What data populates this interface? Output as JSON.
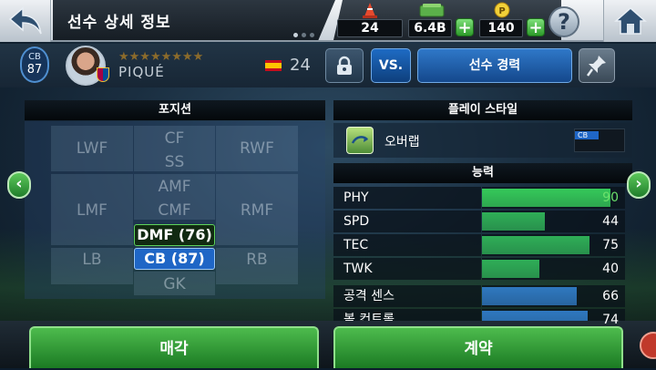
{
  "header": {
    "title": "선수 상세 정보",
    "dots": 3,
    "active_dot": 0
  },
  "resources": {
    "tickets": "24",
    "gp": "6.4B",
    "coins": "140"
  },
  "player": {
    "position": "CB",
    "rating": "87",
    "stars": "★★★★★★★★",
    "name": "PIQUÉ",
    "age": "24",
    "nation": "Spain",
    "club": "FC Barcelona"
  },
  "actions": {
    "vs_label": "VS.",
    "career_label": "선수 경력"
  },
  "positions": {
    "header": "포지션",
    "cells": {
      "lwf": "LWF",
      "cf": "CF",
      "rwf": "RWF",
      "ss": "SS",
      "amf": "AMF",
      "lmf": "LMF",
      "cmf": "CMF",
      "rmf": "RMF",
      "lb": "LB",
      "rb": "RB",
      "gk": "GK"
    },
    "dmf": "DMF (76)",
    "cb": "CB (87)"
  },
  "playstyle": {
    "header": "플레이 스타일",
    "label": "오버랩",
    "tag": "CB"
  },
  "abilities": {
    "header": "능력",
    "stats": [
      {
        "name": "PHY",
        "value": 90,
        "color": "#35c95a",
        "text_color": "#6be06b"
      },
      {
        "name": "SPD",
        "value": 44,
        "color": "#2fae57",
        "text_color": "#ffffff"
      },
      {
        "name": "TEC",
        "value": 75,
        "color": "#2fae57",
        "text_color": "#ffffff"
      },
      {
        "name": "TWK",
        "value": 40,
        "color": "#2fae57",
        "text_color": "#ffffff"
      },
      {
        "name": "공격 센스",
        "value": 66,
        "color": "#2f78c0",
        "text_color": "#ffffff"
      },
      {
        "name": "볼 컨트롤",
        "value": 74,
        "color": "#2f78c0",
        "text_color": "#ffffff"
      }
    ]
  },
  "buttons": {
    "sell": "매각",
    "contract": "계약"
  },
  "colors": {
    "accent_green": "#2d9a2a",
    "accent_blue": "#1f66c6"
  }
}
